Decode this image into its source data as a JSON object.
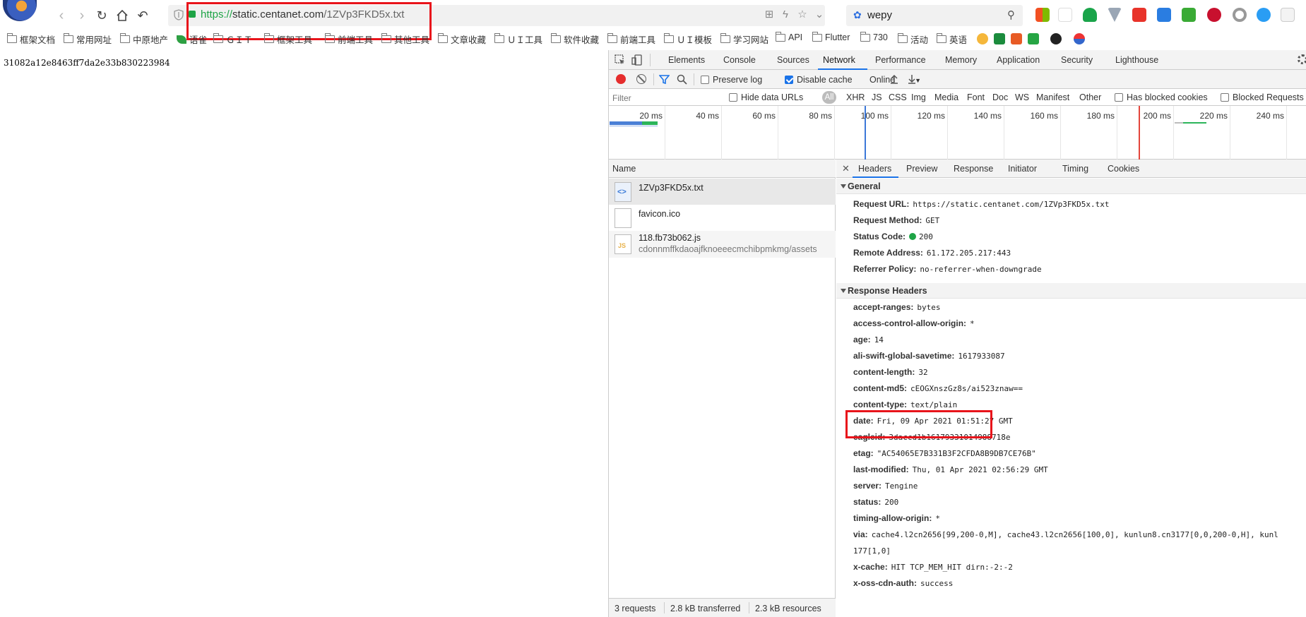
{
  "browser": {
    "address": {
      "scheme": "https://",
      "host": "static.centanet.com",
      "path": "/1ZVp3FKD5x.txt"
    },
    "search": {
      "value": "wepy"
    }
  },
  "bookmarks": [
    {
      "label": "框架文档"
    },
    {
      "label": "常用网址"
    },
    {
      "label": "中原地产"
    },
    {
      "label": "语雀"
    },
    {
      "label": "ＧＩＴ"
    },
    {
      "label": "框架工具"
    },
    {
      "label": "前端工具"
    },
    {
      "label": "其他工具"
    },
    {
      "label": "文章收藏"
    },
    {
      "label": "ＵＩ工具"
    },
    {
      "label": "软件收藏"
    },
    {
      "label": "前端工具"
    },
    {
      "label": "ＵＩ模板"
    },
    {
      "label": "学习网站"
    },
    {
      "label": "API"
    },
    {
      "label": "Flutter"
    },
    {
      "label": "730"
    },
    {
      "label": "活动"
    },
    {
      "label": "英语"
    }
  ],
  "page": {
    "content": "31082a12e8463ff7da2e33b830223984"
  },
  "devtools": {
    "tabs": [
      "Elements",
      "Console",
      "Sources",
      "Network",
      "Performance",
      "Memory",
      "Application",
      "Security",
      "Lighthouse"
    ],
    "active_tab": "Network",
    "toolbar": {
      "preserve_log": "Preserve log",
      "disable_cache": "Disable cache",
      "throttle": "Online"
    },
    "filter": {
      "placeholder": "Filter",
      "hide_data_urls": "Hide data URLs",
      "all": "All",
      "types": [
        "XHR",
        "JS",
        "CSS",
        "Img",
        "Media",
        "Font",
        "Doc",
        "WS",
        "Manifest",
        "Other"
      ],
      "has_blocked_cookies": "Has blocked cookies",
      "blocked_requests": "Blocked Requests"
    },
    "timeline_ticks": [
      "20 ms",
      "40 ms",
      "60 ms",
      "80 ms",
      "100 ms",
      "120 ms",
      "140 ms",
      "160 ms",
      "180 ms",
      "200 ms",
      "220 ms",
      "240 ms"
    ],
    "list": {
      "header": "Name",
      "requests": [
        {
          "name": "1ZVp3FKD5x.txt",
          "sub": ""
        },
        {
          "name": "favicon.ico",
          "sub": ""
        },
        {
          "name": "118.fb73b062.js",
          "sub": "cdonnmffkdaoajfknoeeecmchibpmkmg/assets"
        }
      ],
      "footer": {
        "requests": "3 requests",
        "transferred": "2.8 kB transferred",
        "resources": "2.3 kB resources"
      }
    },
    "detail": {
      "tabs": [
        "Headers",
        "Preview",
        "Response",
        "Initiator",
        "Timing",
        "Cookies"
      ],
      "general_title": "General",
      "general": [
        {
          "k": "Request URL:",
          "v": "https://static.centanet.com/1ZVp3FKD5x.txt"
        },
        {
          "k": "Request Method:",
          "v": "GET"
        },
        {
          "k": "Status Code:",
          "v": "200"
        },
        {
          "k": "Remote Address:",
          "v": "61.172.205.217:443"
        },
        {
          "k": "Referrer Policy:",
          "v": "no-referrer-when-downgrade"
        }
      ],
      "response_title": "Response Headers",
      "response": [
        {
          "k": "accept-ranges:",
          "v": "bytes"
        },
        {
          "k": "access-control-allow-origin:",
          "v": "*"
        },
        {
          "k": "age:",
          "v": "14"
        },
        {
          "k": "ali-swift-global-savetime:",
          "v": "1617933087"
        },
        {
          "k": "content-length:",
          "v": "32"
        },
        {
          "k": "content-md5:",
          "v": "cEOGXnszGz8s/ai523znaw=="
        },
        {
          "k": "content-type:",
          "v": "text/plain"
        },
        {
          "k": "date:",
          "v": "Fri, 09 Apr 2021 01:51:27 GMT"
        },
        {
          "k": "eagleid:",
          "v": "3daccd1b16179331014988718e"
        },
        {
          "k": "etag:",
          "v": "\"AC54065E7B331B3F2CFDA8B9DB7CE76B\""
        },
        {
          "k": "last-modified:",
          "v": "Thu, 01 Apr 2021 02:56:29 GMT"
        },
        {
          "k": "server:",
          "v": "Tengine"
        },
        {
          "k": "status:",
          "v": "200"
        },
        {
          "k": "timing-allow-origin:",
          "v": "*"
        },
        {
          "k": "via:",
          "v": "cache4.l2cn2656[99,200-0,M], cache43.l2cn2656[100,0], kunlun8.cn3177[0,0,200-0,H], kunl"
        },
        {
          "k": "",
          "v": "177[1,0]"
        },
        {
          "k": "x-cache:",
          "v": "HIT TCP_MEM_HIT dirn:-2:-2"
        },
        {
          "k": "x-oss-cdn-auth:",
          "v": "success"
        }
      ]
    }
  }
}
